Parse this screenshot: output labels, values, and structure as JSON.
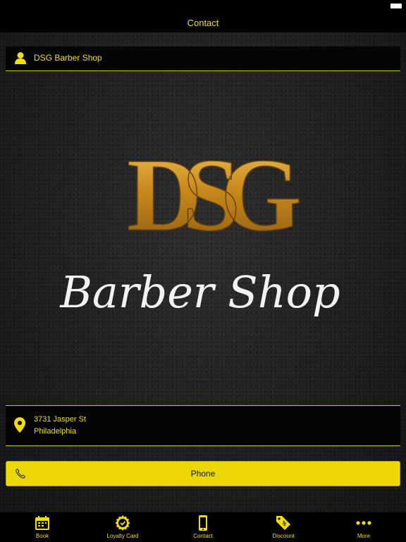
{
  "nav": {
    "title": "Contact"
  },
  "business": {
    "name": "DSG Barber Shop",
    "logo_monogram": "DSG",
    "logo_script": "Barber Shop"
  },
  "address": {
    "line1": "3731 Jasper St",
    "line2": "Philadelphia"
  },
  "phone_button": {
    "label": "Phone"
  },
  "tabs": [
    {
      "label": "Book",
      "icon": "calendar-icon"
    },
    {
      "label": "Loyalty Card",
      "icon": "badge-icon"
    },
    {
      "label": "Contact",
      "icon": "phone-device-icon"
    },
    {
      "label": "Discount",
      "icon": "discount-tag-icon"
    },
    {
      "label": "More",
      "icon": "more-dots-icon"
    }
  ],
  "colors": {
    "accent": "#f2de06",
    "button": "#ecd706",
    "background": "#000000",
    "gold": "#c8891c"
  }
}
